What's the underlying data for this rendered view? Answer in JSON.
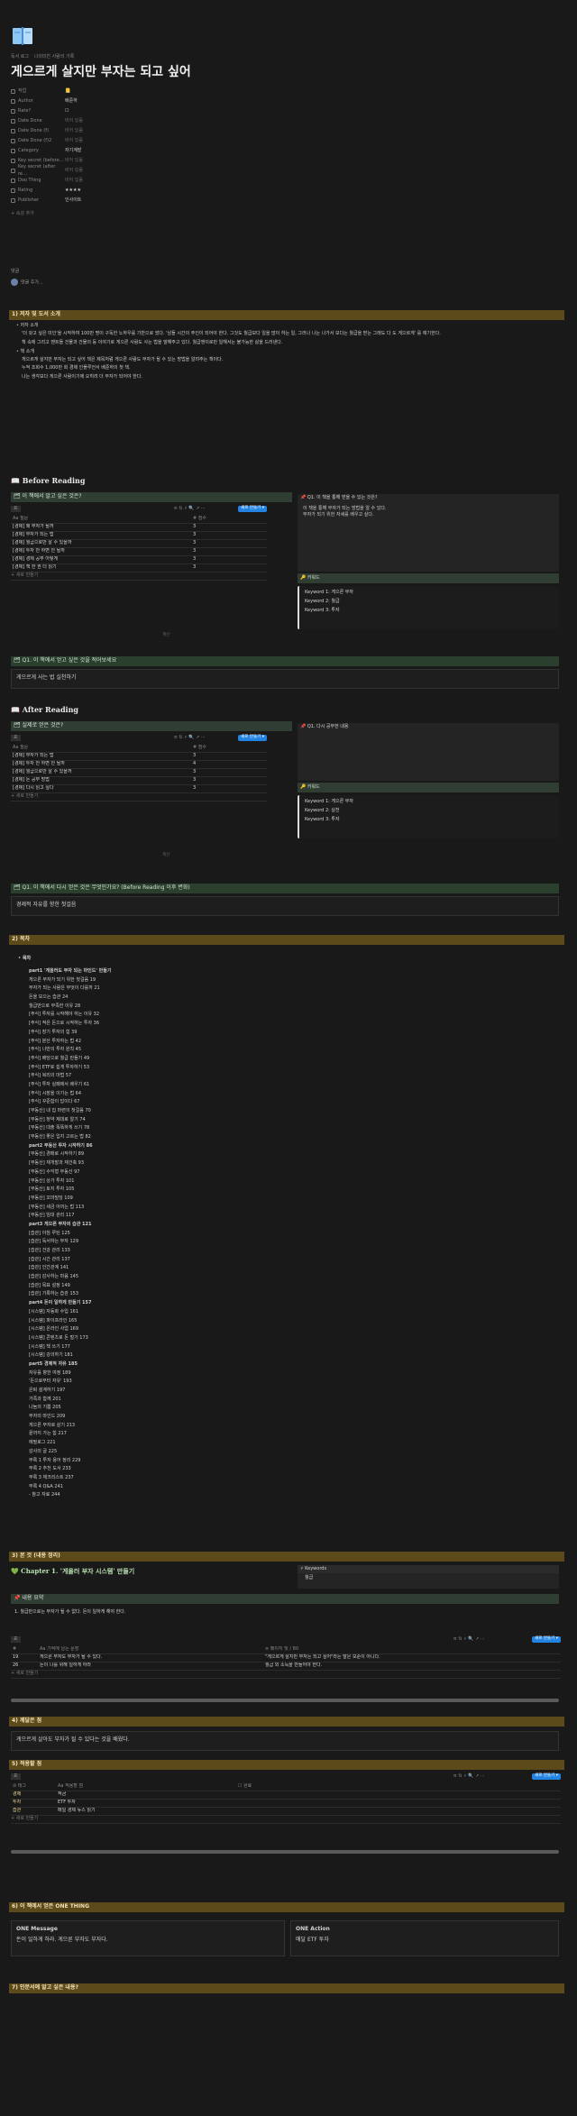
{
  "page": {
    "title": "게으르게 살지만 부자는 되고 싶어",
    "breadcrumb": [
      "독서 로그",
      "나의미친 사람의 기록"
    ]
  },
  "props": [
    {
      "k": "작업",
      "v": "📒"
    },
    {
      "k": "Author",
      "v": "배준하"
    },
    {
      "k": "Rate?",
      "v": "☐"
    },
    {
      "k": "Date Done",
      "v": "비어 있음"
    },
    {
      "k": "Date Done (f)",
      "v": "비어 있음"
    },
    {
      "k": "Date Done (f)2",
      "v": "비어 있음"
    },
    {
      "k": "Category",
      "v": "자기계발"
    },
    {
      "k": "Key secret (before…",
      "v": "비어 있음"
    },
    {
      "k": "Key secret (after re…",
      "v": "비어 있음"
    },
    {
      "k": "Doo Thing",
      "v": "비어 있음"
    },
    {
      "k": "Rating",
      "v": "★★★★"
    },
    {
      "k": "Publisher",
      "v": "인사이트"
    }
  ],
  "more": "+ 속성 추가",
  "comments": {
    "label": "댓글",
    "placeholder": "댓글 추가..."
  },
  "s1": {
    "h": "1) 저자 및 도서 소개",
    "author_h": "저자 소개",
    "a1": "'더 갖고 싶은 미인'을 시작하여 100만 명이 구독한 노하우를 기반으로 썼다. '남들 시간의 주인이 되어야 한다. 그것도 월급보다 일을 많이 하는 일, 그러나 나는 나가서 보다는 월급을 받는 그래도 다 도 게으르게' 를 얘기한다.",
    "a2": "책 속에 그리고 멘트들 건물과 건물의 등 이야기로 게으른 사람도 사는 법을 말해주고 있다. 월급쟁이로만 일해서는 불가능한 삶을 드러낸다.",
    "book_h": "책 소개",
    "b1": "게으르게 살지만 부자는 되고 싶어 책은 제목처럼 게으른 사람도 부자가 될 수 있는 방법을 알려주는 책이다.",
    "b2": "누적 조회수 1,000만 회 경제 인플루언서 배준하의 첫 책.",
    "b3": "나는 생각보다 게으른 사람이기에 오히려 더 부자가 되어야 한다."
  },
  "s1b": {
    "title": "📖 Before Reading",
    "db1": "🗂 이 책에서 알고 싶은 것은?",
    "tab": "표",
    "cols": [
      "Aa 질문",
      "# 점수"
    ],
    "rows": [
      [
        "[경제] 왜 부자가 될까",
        "3"
      ],
      [
        "[경제] 부자가 되는 법",
        "3"
      ],
      [
        "[경제] 월급으로만 살 수 있을까",
        "3"
      ],
      [
        "[경제] 투자 안 하면 안 될까",
        "3"
      ],
      [
        "[경제] 경제 공부 어떻게",
        "3"
      ],
      [
        "[경제] 책 한 권 더 읽기",
        "3"
      ]
    ],
    "newrow": "+ 새로 만들기",
    "count": "계산",
    "keys_h": "🔑 키워드",
    "keys": [
      "Keyword 1: 게으른 부자",
      "Keyword 2: 월급",
      "Keyword 3: 투자"
    ],
    "note_h": "📌 Q1. 이 책을 통해 얻을 수 있는 것은?",
    "notes": [
      "이 책을 통해 부자가 되는 방법을 알 수 있다.",
      "부자가 되기 위한 자세를 배우고 싶다."
    ],
    "q_h": "🗂 Q1. 이 책에서 얻고 싶은 것을 적어보세요",
    "q_v": "게으르게 사는 법 실천하기"
  },
  "s1c": {
    "title": "📖 After Reading",
    "db1": "🗂 실제로 얻은 것은?",
    "tab": "표",
    "cols": [
      "Aa 질문",
      "# 점수"
    ],
    "rows": [
      [
        "[경제] 부자가 되는 법",
        "3"
      ],
      [
        "[경제] 투자 안 하면 안 될까",
        "4"
      ],
      [
        "[경제] 월급으로만 살 수 있을까",
        "3"
      ],
      [
        "[경제] 돈 공부 방법",
        "3"
      ],
      [
        "[경제] 다시 읽고 싶다",
        "3"
      ]
    ],
    "newrow": "+ 새로 만들기",
    "count": "계산",
    "keys": [
      "Keyword 1: 게으른 부자",
      "Keyword 2: 실천",
      "Keyword 3: 투자"
    ],
    "note_h": "📌 Q1. 다시 공부한 내용",
    "q_h": "🗂 Q1. 이 책에서 다시 얻은 것은 무엇인가요? (Before Reading 이후 변화)",
    "q_v": "경제적 자유를 향한 첫걸음"
  },
  "s2": {
    "h": "2) 목차",
    "toc_h": "목차",
    "toc": [
      "part1 '게을러도 부자 되는 마인드' 만들기",
      "게으른 부자가 되기 위한 첫걸음 19",
      "부자가 되는 사람은 무엇이 다를까 21",
      "돈을 모으는 습관 24",
      "월급만으로 부족한 이유 28",
      "[주식] 투자를 시작해야 하는 이유 32",
      "[주식] 적은 돈으로 시작하는 투자 36",
      "[주식] 장기 투자의 힘 39",
      "[주식] 분산 투자하는 법 42",
      "[주식] 나만의 투자 원칙 45",
      "[주식] 배당으로 월급 만들기 49",
      "[주식] ETF로 쉽게 투자하기 53",
      "[주식] 복리의 마법 57",
      "[주식] 투자 실패에서 배우기 61",
      "[주식] 시장을 이기는 법 64",
      "[주식] 꾸준함이 답이다 67",
      "[부동산] 내 집 마련의 첫걸음 70",
      "[부동산] 청약 제대로 알기 74",
      "[부동산] 대출 똑똑하게 쓰기 78",
      "[부동산] 좋은 입지 고르는 법 82",
      "part2 부동산 투자 시작하기 86",
      "[부동산] 경매로 시작하기 89",
      "[부동산] 재개발과 재건축 93",
      "[부동산] 수익형 부동산 97",
      "[부동산] 상가 투자 101",
      "[부동산] 토지 투자 105",
      "[부동산] 꼬마빌딩 109",
      "[부동산] 세금 아끼는 법 113",
      "[부동산] 임대 관리 117",
      "part3 게으른 부자의 습관 121",
      "[습관] 아침 루틴 125",
      "[습관] 독서하는 부자 129",
      "[습관] 건강 관리 133",
      "[습관] 시간 관리 137",
      "[습관] 인간관계 141",
      "[습관] 감사하는 마음 145",
      "[습관] 목표 설정 149",
      "[습관] 기록하는 습관 153",
      "part4 돈이 일하게 만들기 157",
      "[시스템] 자동화 수입 161",
      "[시스템] 파이프라인 165",
      "[시스템] 온라인 사업 169",
      "[시스템] 콘텐츠로 돈 벌기 173",
      "[시스템] 책 쓰기 177",
      "[시스템] 강의하기 181",
      "part5 경제적 자유 185",
      "자유를 향한 여정 189",
      "'돈으로부터 자유' 193",
      "은퇴 설계하기 197",
      "가족과 함께 201",
      "나눔의 기쁨 205",
      "부자의 마인드 209",
      "게으른 부자로 살기 213",
      "끝까지 가는 힘 217",
      "에필로그 221",
      "감사의 글 225",
      "부록 1 투자 용어 정리 229",
      "부록 2 추천 도서 233",
      "부록 3 체크리스트 237",
      "부록 4 Q&A 241",
      "- 참고 자료 244"
    ]
  },
  "s3": {
    "h": "3) 본 것 (내용 정리)",
    "ch": "💚 Chapter 1. '게을러 부자 시스템' 만들기",
    "kw_h": "⚡ Keywords",
    "kw_v": "월급",
    "summary_h": "📌 내용 요약",
    "summary": "1.  월급만으로는 부자가 될 수 없다. 돈이 일하게 해야 한다.",
    "tab": "표",
    "cols": [
      "#",
      "Aa 기억에 남는 문장",
      "≡ 페이지 및 / 80"
    ],
    "rows": [
      [
        "19",
        "게으른 부자도 부자가 될 수 있다.",
        "\"게으르게 살지만 부자는 되고 싶어\"라는 말은 모순이 아니다."
      ],
      [
        "26",
        "돈이 나를 위해 일하게 하라",
        "월급 외 소득을 만들어야 한다."
      ]
    ],
    "newrow": "+ 새로 만들기"
  },
  "s4": {
    "h": "4) 깨달은 점",
    "v": "게으르게 살아도 부자가 될 수 있다는 것을 배웠다."
  },
  "s5": {
    "h": "5) 적용할 점",
    "tab": "표",
    "cols": [
      "⊘ 태그",
      "Aa 적용할 점",
      "☐ 완료"
    ],
    "rows": [
      [
        "경제",
        "적금",
        ""
      ],
      [
        "투자",
        "ETF 투자",
        ""
      ],
      [
        "습관",
        "매일 경제 뉴스 읽기",
        ""
      ]
    ],
    "newrow": "+ 새로 만들기"
  },
  "s6": {
    "h": "6) 이 책에서 얻은 ONE THING",
    "m_h": "ONE Message",
    "m_v": "돈이 일하게 하라. 게으른 부자도 부자다.",
    "a_h": "ONE Action",
    "a_v": "매달 ETF 투자"
  },
  "s7": {
    "h": "7) 인문서에 알고 싶은 내용?"
  }
}
